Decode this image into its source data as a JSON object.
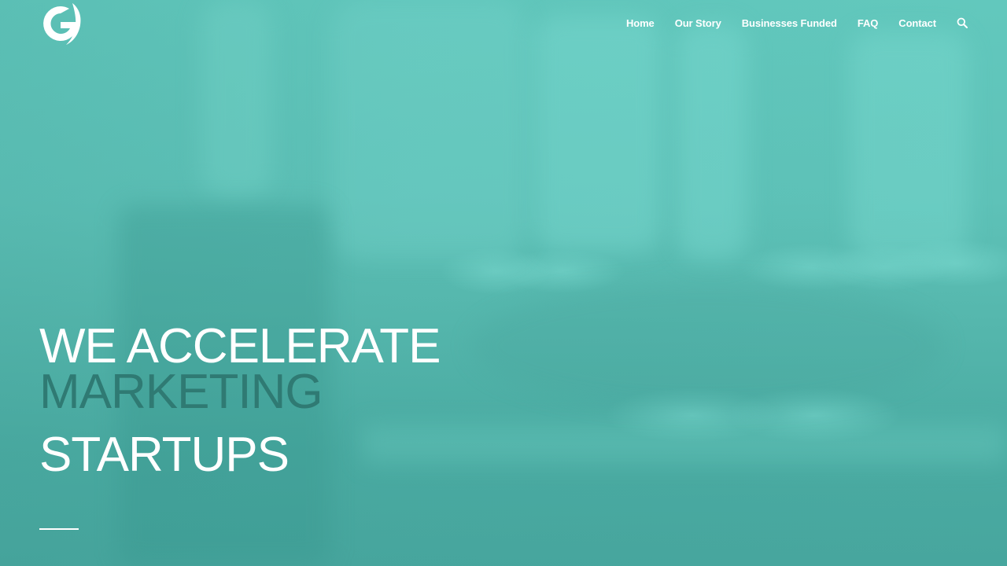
{
  "brand": {
    "logo_icon": "g-logo-icon",
    "accent_color": "#2f7a73",
    "background_color": "#54b6ad",
    "text_color": "#ffffff"
  },
  "nav": {
    "items": [
      {
        "label": "Home"
      },
      {
        "label": "Our Story"
      },
      {
        "label": "Businesses Funded"
      },
      {
        "label": "FAQ"
      },
      {
        "label": "Contact"
      }
    ],
    "search_icon": "search-icon"
  },
  "hero": {
    "line1": "WE ACCELERATE",
    "line2": "MARKETING",
    "line3": "STARTUPS"
  }
}
